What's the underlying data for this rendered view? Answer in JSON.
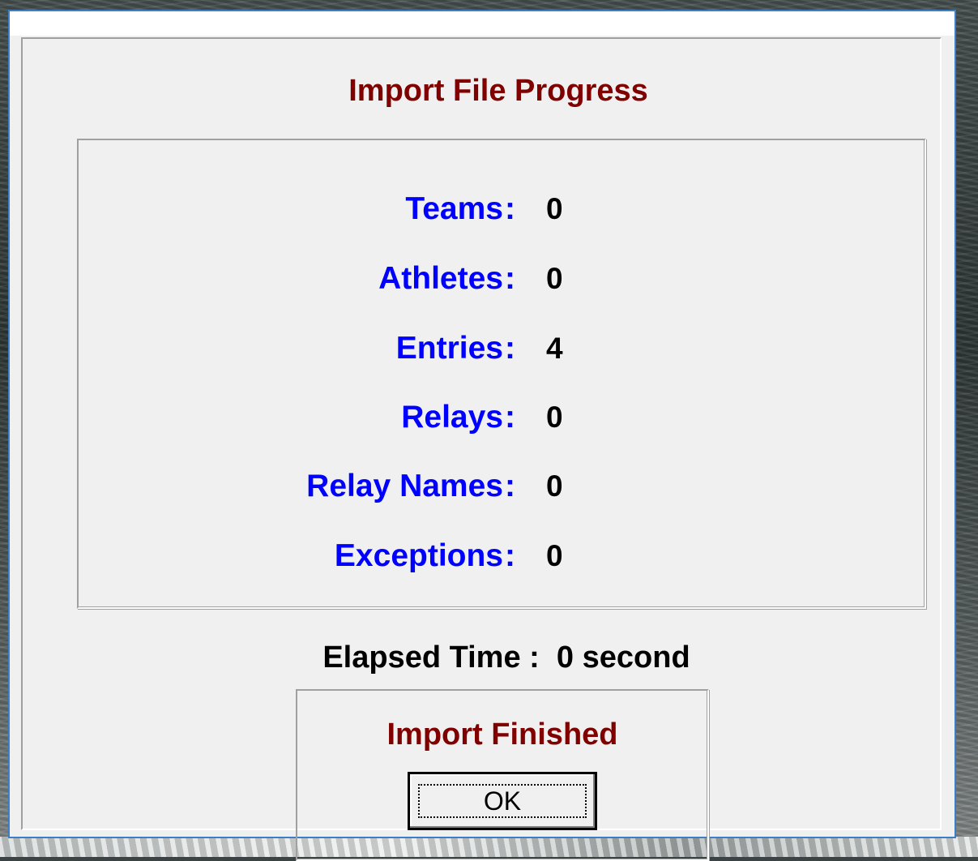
{
  "dialog": {
    "title": "Import File Progress",
    "stats": [
      {
        "label": "Teams",
        "colon": ":",
        "value": "0"
      },
      {
        "label": "Athletes",
        "colon": ":",
        "value": "0"
      },
      {
        "label": "Entries",
        "colon": ":",
        "value": "4"
      },
      {
        "label": "Relays",
        "colon": ":",
        "value": "0"
      },
      {
        "label": "Relay Names",
        "colon": ":",
        "value": "0"
      },
      {
        "label": "Exceptions",
        "colon": ":",
        "value": "0"
      }
    ],
    "elapsed_text": "Elapsed Time :  0 second",
    "status_text": "Import Finished",
    "ok_label": "OK"
  },
  "colors": {
    "title": "#800000",
    "label": "#0000ff",
    "value": "#000000",
    "window_border": "#3c7fc4",
    "dialog_bg": "#f0f0f0"
  }
}
